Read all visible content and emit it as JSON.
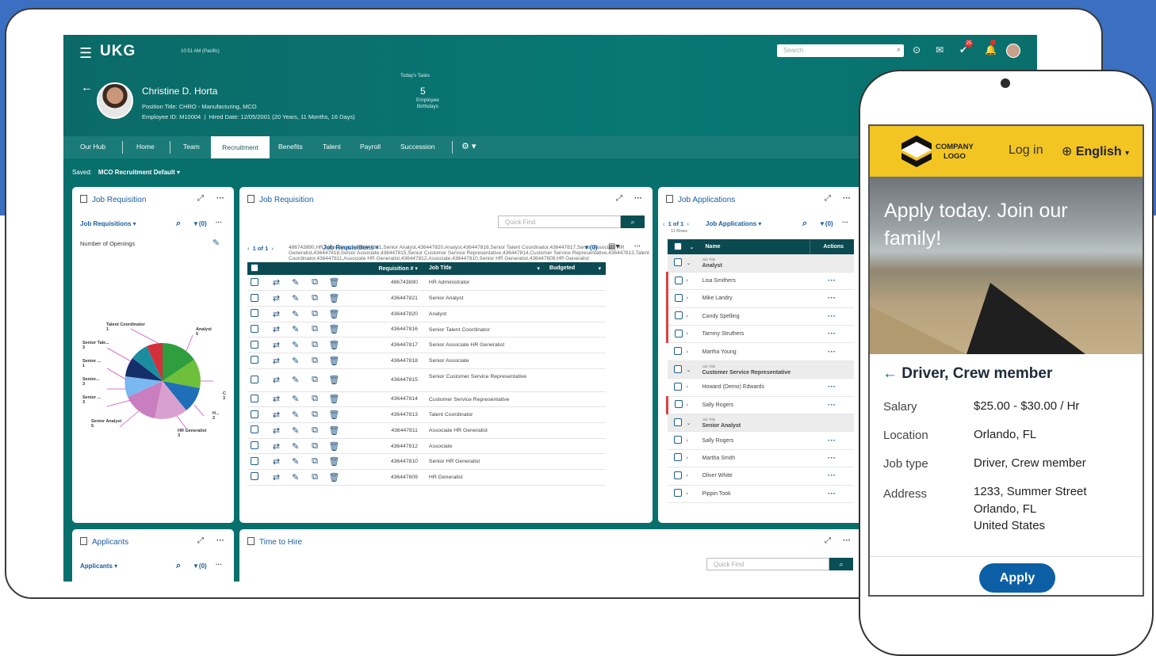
{
  "app": {
    "logo": "UKG",
    "time": "10:51 AM (Pacific)",
    "search_placeholder": "Search",
    "badge1": "25"
  },
  "profile": {
    "name": "Christine D. Horta",
    "position": "Position Title: CHRO - Manufacturing, MCO",
    "employee_id": "Employee ID: M10004",
    "hired": "Hired Date: 12/05/2001 (20 Years, 11 Months, 16 Days)",
    "tasks_label": "Today's Tasks",
    "birthday_count": "5",
    "birthday_label1": "Employee",
    "birthday_label2": "Birthdays"
  },
  "nav": {
    "items": [
      "Our Hub",
      "Home",
      "Team",
      "Recruitment",
      "Benefits",
      "Talent",
      "Payroll",
      "Succession"
    ],
    "active": "Recruitment"
  },
  "saved": {
    "label": "Saved:",
    "value": "MCO Recruitment Default"
  },
  "panel1": {
    "title": "Job Requisition",
    "dropdown": "Job Requisitions",
    "filter": "(0)",
    "metric": "Number of Openings",
    "pie_labels": [
      {
        "name": "Talent Coordinator",
        "value": "1"
      },
      {
        "name": "Analyst",
        "value": "5"
      },
      {
        "name": "Senior Tale...",
        "value": "3"
      },
      {
        "name": "Senior ...",
        "value": "1"
      },
      {
        "name": "Senior...",
        "value": "3"
      },
      {
        "name": "Senior ...",
        "value": "3"
      },
      {
        "name": "Senior Analyst",
        "value": "5"
      },
      {
        "name": "HR Generalist",
        "value": "3"
      },
      {
        "name": "H...",
        "value": "2"
      },
      {
        "name": "C",
        "value": "3"
      }
    ]
  },
  "panel2": {
    "title": "Job Requisition",
    "quick_find": "Quick Find",
    "pager": "1 of 1",
    "rows": [
      [
        "486743890",
        "HR Administrator"
      ],
      [
        "436447821",
        "Senior Analyst"
      ],
      [
        "436447820",
        "Analyst"
      ],
      [
        "436447816",
        "Senior Talent Coordinator"
      ],
      [
        "436447817",
        "Senior Associate HR Generalist"
      ],
      [
        "436447818",
        "Senior Associate"
      ],
      [
        "436447815",
        "Senior Customer Service Representative"
      ],
      [
        "436447814",
        "Customer Service Representative"
      ],
      [
        "436447813",
        "Talent Coordinator"
      ],
      [
        "436447811",
        "Associate HR Generalist"
      ],
      [
        "436447812",
        "Associate"
      ],
      [
        "436447810",
        "Senior HR Generalist"
      ],
      [
        "436447809",
        "HR Generalist"
      ]
    ],
    "dropdown": "Job Requisitions",
    "filter": "(0)",
    "columns": [
      "Requisition #",
      "Job Title",
      "Budgeted"
    ]
  },
  "panel3": {
    "title": "Job Applications",
    "pager": "1 of 1",
    "rows": "11 Rows",
    "dropdown": "Job Applications",
    "filter": "(0)",
    "columns": [
      "Name",
      "Actions"
    ],
    "group_label": "Job Title",
    "groups": [
      {
        "title": "Analyst",
        "people": [
          "Lisa Smithers",
          "Mike Landry",
          "Candy Spelling",
          "Tammy Struthers",
          "Martha Young"
        ]
      },
      {
        "title": "Customer Service Representative",
        "people": [
          "Howard (Demo) Edwards",
          "Sally Rogers"
        ]
      },
      {
        "title": "Senior Analyst",
        "people": [
          "Sally Rogers",
          "Martha Smith",
          "Oliver White",
          "Pippin Took"
        ]
      }
    ]
  },
  "panel4": {
    "title": "Applicants",
    "dropdown": "Applicants",
    "filter": "(0)"
  },
  "panel5": {
    "title": "Time to Hire",
    "quick_find": "Quick Find"
  },
  "mobile": {
    "company_logo_1": "COMPANY",
    "company_logo_2": "LOGO",
    "login": "Log in",
    "language": "English",
    "hero1": "Apply today. Join our",
    "hero2": "family!",
    "job_title": "Driver, Crew member",
    "fields": [
      {
        "label": "Salary",
        "value": "$25.00 - $30.00 / Hr"
      },
      {
        "label": "Location",
        "value": "Orlando, FL"
      },
      {
        "label": "Job type",
        "value": "Driver, Crew member"
      },
      {
        "label": "Address",
        "value": "1233, Summer Street"
      }
    ],
    "address2": "Orlando, FL",
    "address3": "United States",
    "apply": "Apply"
  }
}
